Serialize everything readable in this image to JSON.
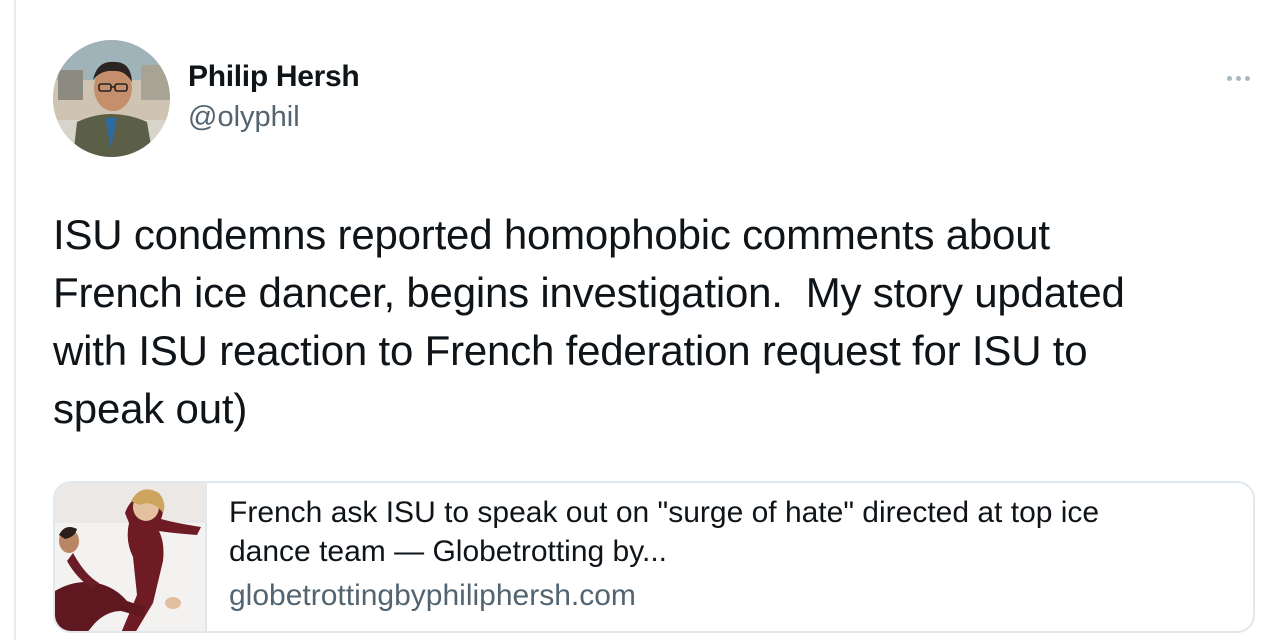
{
  "tweet": {
    "author": {
      "display_name": "Philip Hersh",
      "handle": "@olyphil"
    },
    "text": "ISU condemns reported homophobic comments about\nFrench ice dancer, begins investigation.  My story updated\nwith ISU reaction to French federation request for ISU to\nspeak out)",
    "more_icon": "ellipsis-icon"
  },
  "link_card": {
    "title": "French ask ISU to speak out on \"surge of hate\" directed at top ice\ndance team — Globetrotting by...",
    "domain": "globetrottingbyphiliphersh.com"
  },
  "colors": {
    "text_primary": "#0f1419",
    "text_secondary": "#536471",
    "border": "#e1e8ed"
  }
}
